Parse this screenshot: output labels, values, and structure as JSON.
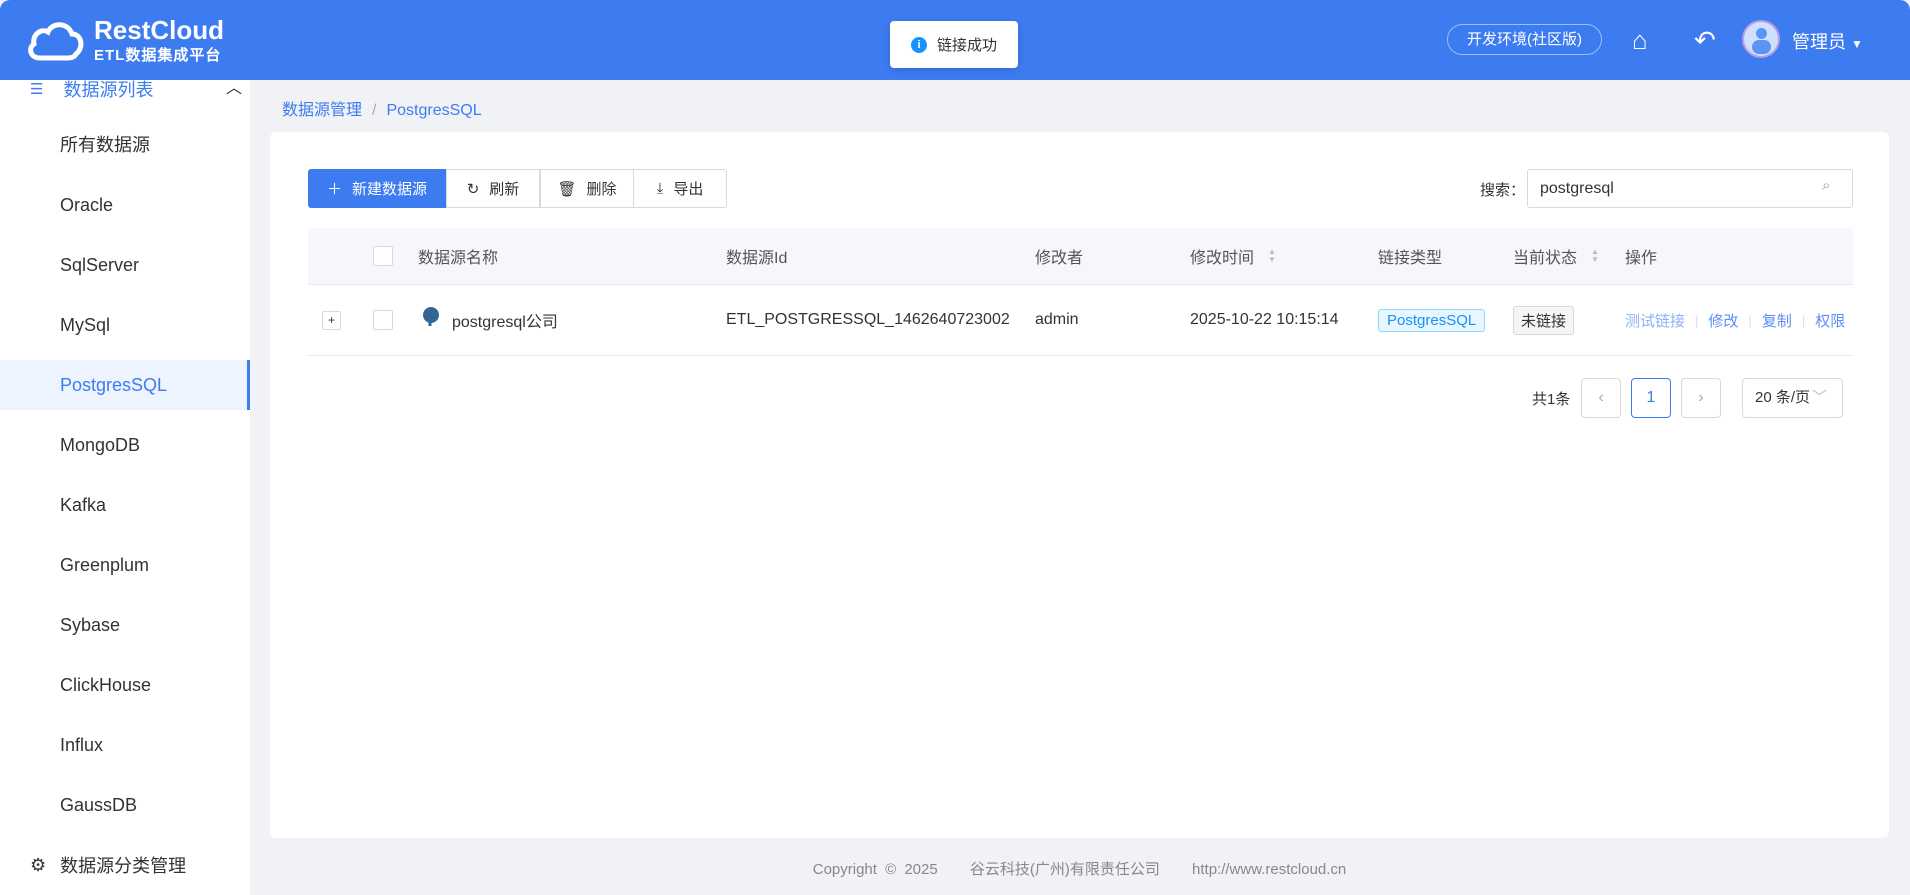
{
  "header": {
    "brand": "RestCloud",
    "subtitle": "ETL数据集成平台",
    "env": "开发环境(社区版)",
    "user": "管理员"
  },
  "toast": {
    "message": "链接成功"
  },
  "sidebar": {
    "group": "数据源列表",
    "items": [
      "所有数据源",
      "Oracle",
      "SqlServer",
      "MySql",
      "PostgresSQL",
      "MongoDB",
      "Kafka",
      "Greenplum",
      "Sybase",
      "ClickHouse",
      "Influx",
      "GaussDB"
    ],
    "active": "PostgresSQL",
    "bottom": "数据源分类管理"
  },
  "breadcrumb": [
    "数据源管理",
    "PostgresSQL"
  ],
  "toolbar": {
    "new": "新建数据源",
    "refresh": "刷新",
    "delete": "删除",
    "export": "导出",
    "search_label": "搜索：",
    "search_value": "postgresql"
  },
  "table": {
    "headers": [
      "数据源名称",
      "数据源Id",
      "修改者",
      "修改时间",
      "链接类型",
      "当前状态",
      "操作"
    ],
    "rows": [
      {
        "name": "postgresql公司",
        "id": "ETL_POSTGRESSQL_1462640723002",
        "modifier": "admin",
        "time": "2025-10-22 10:15:14",
        "type": "PostgresSQL",
        "status": "未链接",
        "actions": [
          "测试链接",
          "修改",
          "复制",
          "权限"
        ]
      }
    ]
  },
  "pagination": {
    "total": "共1条",
    "page": "1",
    "size": "20 条/页"
  },
  "footer": {
    "copyright": "Copyright © 2025",
    "company": "谷云科技(广州)有限责任公司",
    "url": "http://www.restcloud.cn"
  }
}
